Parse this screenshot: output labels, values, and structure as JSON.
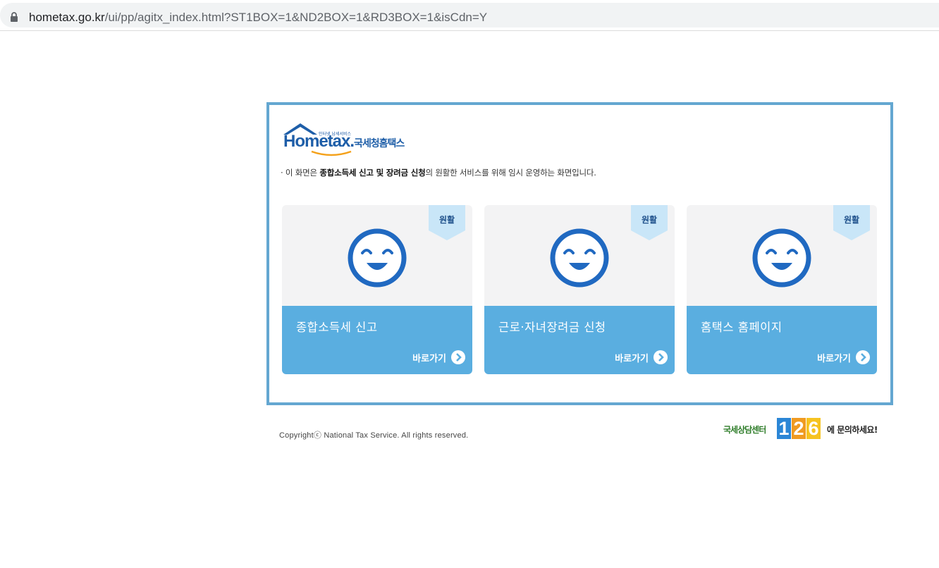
{
  "browser": {
    "url_host": "hometax.go.kr",
    "url_path": "/ui/pp/agitx_index.html?ST1BOX=1&ND2BOX=1&RD3BOX=1&isCdn=Y"
  },
  "logo": {
    "small_text": "인터넷 납세서비스",
    "main_text": "Hometax.",
    "kr_text": "국세청홈택스"
  },
  "notice": {
    "prefix": "· 이 화면은 ",
    "bold": "종합소득세 신고 및 장려금 신청",
    "suffix": "의 원활한 서비스를 위해 임시 운영하는 화면입니다."
  },
  "cards": [
    {
      "status": "원활",
      "title": "종합소득세 신고",
      "link_label": "바로가기"
    },
    {
      "status": "원활",
      "title": "근로·자녀장려금 신청",
      "link_label": "바로가기"
    },
    {
      "status": "원활",
      "title": "홈택스 홈페이지",
      "link_label": "바로가기"
    }
  ],
  "footer": {
    "copyright": "Copyrightⓒ National Tax Service. All rights reserved.",
    "center_label": "국세상담센터",
    "center_digits": [
      "1",
      "2",
      "6"
    ],
    "center_suffix": "에 문의하세요!"
  },
  "colors": {
    "panel_border": "#64a7d1",
    "card_bottom": "#5aaee0",
    "badge": "#c9e6f8",
    "smiley": "#2069c1"
  },
  "icons": {
    "status_icon": "smiley-face-icon",
    "go_icon": "chevron-right-circle-icon",
    "lock_icon": "lock-icon"
  }
}
